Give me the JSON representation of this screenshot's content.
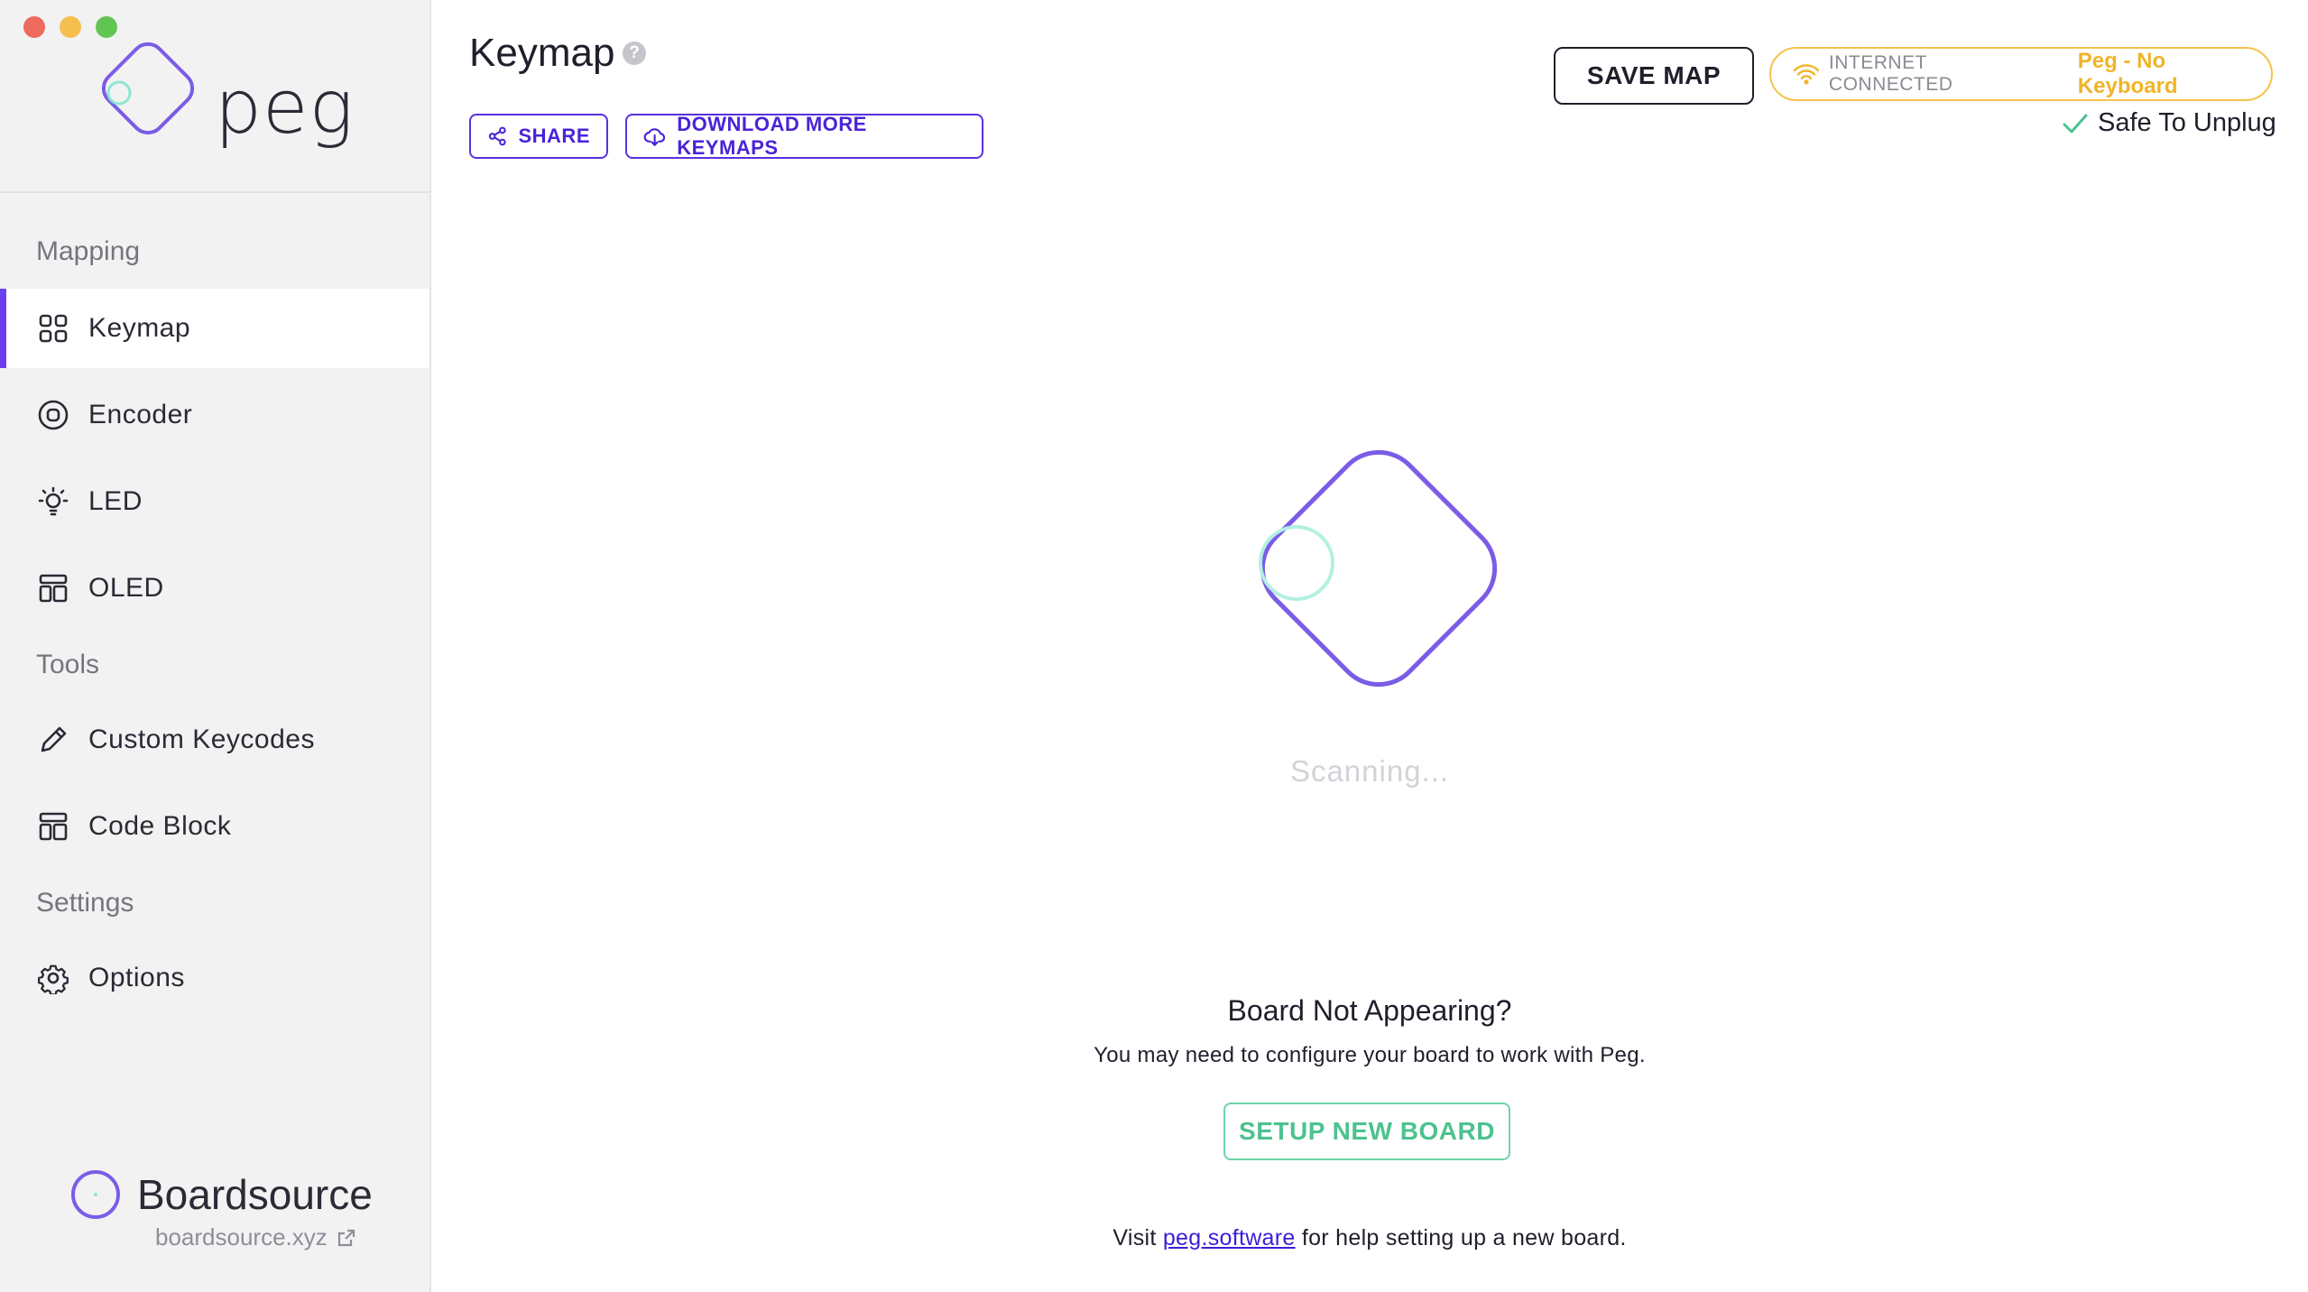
{
  "window": {
    "controls": [
      "close",
      "minimize",
      "maximize"
    ]
  },
  "brand": {
    "name": "peg"
  },
  "sidebar": {
    "sections": [
      {
        "title": "Mapping"
      },
      {
        "title": "Tools"
      },
      {
        "title": "Settings"
      }
    ],
    "items": [
      {
        "label": "Keymap",
        "icon": "grid-icon",
        "active": true
      },
      {
        "label": "Encoder",
        "icon": "encoder-icon"
      },
      {
        "label": "LED",
        "icon": "lightbulb-icon"
      },
      {
        "label": "OLED",
        "icon": "layout-icon"
      },
      {
        "label": "Custom Keycodes",
        "icon": "pencil-icon"
      },
      {
        "label": "Code Block",
        "icon": "layout-icon"
      },
      {
        "label": "Options",
        "icon": "gear-icon"
      }
    ],
    "footer": {
      "name": "Boardsource",
      "url": "boardsource.xyz"
    }
  },
  "header": {
    "title": "Keymap",
    "help": "?",
    "share_label": "SHARE",
    "download_label": "DOWNLOAD MORE KEYMAPS",
    "save_label": "SAVE MAP",
    "connection_label": "INTERNET CONNECTED",
    "keyboard_status": "Peg - No Keyboard",
    "safe_label": "Safe To Unplug"
  },
  "main": {
    "scanning": "Scanning...",
    "heading": "Board Not Appearing?",
    "subtext": "You may need to configure your board to work with Peg.",
    "setup_label": "SETUP NEW BOARD",
    "visit_prefix": "Visit",
    "visit_link": "peg.software",
    "visit_suffix": "for help setting up a new board."
  },
  "colors": {
    "accent": "#6b3ff0",
    "logo": "#7b5ce6",
    "logo_dot": "#8fe6d2",
    "warning": "#f0b429",
    "success": "#4cc28f"
  }
}
